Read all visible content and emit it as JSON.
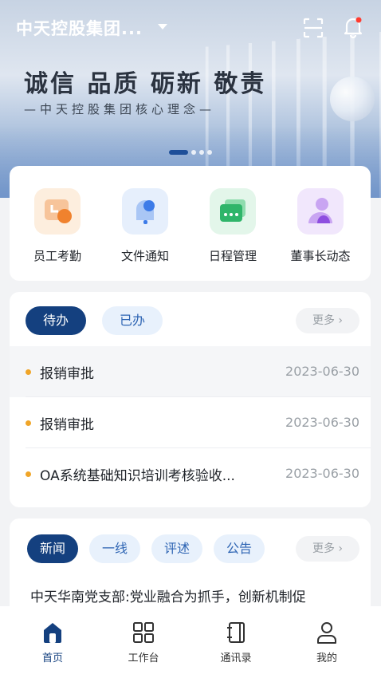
{
  "header": {
    "company": "中天控股集团...",
    "slogan": "诚信 品质 砺新 敬责",
    "sub_slogan": "—中天控股集团核心理念—",
    "icons": [
      "scan-icon",
      "bell-icon"
    ],
    "carousel_pages": 4,
    "carousel_active": 0
  },
  "quick_actions": [
    {
      "label": "员工考勤",
      "icon": "attendance-icon",
      "color": "#f59a3c"
    },
    {
      "label": "文件通知",
      "icon": "notice-icon",
      "color": "#3d7be8"
    },
    {
      "label": "日程管理",
      "icon": "calendar-icon",
      "color": "#2fb56a"
    },
    {
      "label": "董事长动态",
      "icon": "chairman-icon",
      "color": "#9b5ae6"
    }
  ],
  "todo": {
    "tabs": [
      "待办",
      "已办"
    ],
    "active_tab": 0,
    "more": "更多 ›",
    "items": [
      {
        "title": "报销审批",
        "date": "2023-06-30"
      },
      {
        "title": "报销审批",
        "date": "2023-06-30"
      },
      {
        "title": "OA系统基础知识培训考核验收...",
        "date": "2023-06-30"
      }
    ]
  },
  "news": {
    "tabs": [
      "新闻",
      "一线",
      "评述",
      "公告"
    ],
    "active_tab": 0,
    "more": "更多 ›",
    "headline": "中天华南党支部:党业融合为抓手，创新机制促"
  },
  "tabbar": [
    {
      "label": "首页",
      "icon": "home-icon",
      "active": true
    },
    {
      "label": "工作台",
      "icon": "grid-icon",
      "active": false
    },
    {
      "label": "通讯录",
      "icon": "contacts-icon",
      "active": false
    },
    {
      "label": "我的",
      "icon": "profile-icon",
      "active": false
    }
  ],
  "colors": {
    "primary": "#14407f",
    "bullet": "#f0a528"
  }
}
